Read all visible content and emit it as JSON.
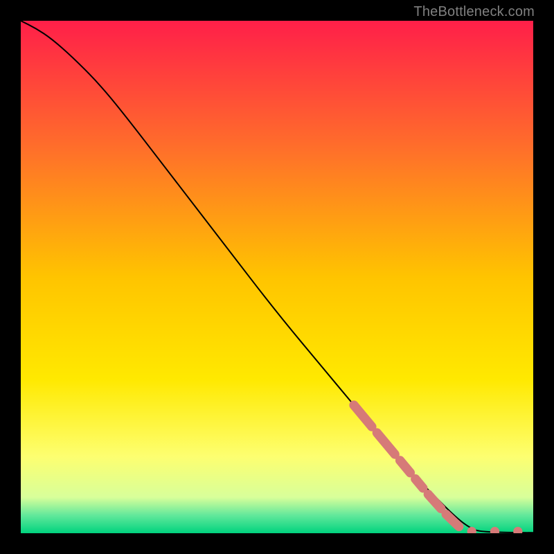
{
  "branding": {
    "text": "TheBottleneck.com"
  },
  "chart_data": {
    "type": "line",
    "title": "",
    "xlabel": "",
    "ylabel": "",
    "xlim": [
      0,
      100
    ],
    "ylim": [
      0,
      100
    ],
    "grid": false,
    "background_gradient": {
      "stops": [
        {
          "offset": 0.0,
          "color": "#ff1f49"
        },
        {
          "offset": 0.25,
          "color": "#ff6f2a"
        },
        {
          "offset": 0.5,
          "color": "#ffc400"
        },
        {
          "offset": 0.7,
          "color": "#ffe900"
        },
        {
          "offset": 0.85,
          "color": "#fdff70"
        },
        {
          "offset": 0.93,
          "color": "#d8ff9a"
        },
        {
          "offset": 0.965,
          "color": "#62e89b"
        },
        {
          "offset": 1.0,
          "color": "#00d37e"
        }
      ]
    },
    "series": [
      {
        "name": "curve",
        "stroke": "#000000",
        "stroke_width": 2,
        "points": [
          {
            "x": 0,
            "y": 100
          },
          {
            "x": 3,
            "y": 98.5
          },
          {
            "x": 6,
            "y": 96.5
          },
          {
            "x": 10,
            "y": 93
          },
          {
            "x": 15,
            "y": 88
          },
          {
            "x": 20,
            "y": 82
          },
          {
            "x": 30,
            "y": 69
          },
          {
            "x": 40,
            "y": 56
          },
          {
            "x": 50,
            "y": 43
          },
          {
            "x": 60,
            "y": 31
          },
          {
            "x": 65,
            "y": 25
          },
          {
            "x": 70,
            "y": 19
          },
          {
            "x": 75,
            "y": 13
          },
          {
            "x": 80,
            "y": 8
          },
          {
            "x": 85,
            "y": 3
          },
          {
            "x": 88,
            "y": 0.8
          },
          {
            "x": 90,
            "y": 0.3
          },
          {
            "x": 95,
            "y": 0.15
          },
          {
            "x": 100,
            "y": 0.1
          }
        ]
      }
    ],
    "markers": {
      "name": "dashed-overlay",
      "color": "#d67a78",
      "dot_radius_units": 0.9,
      "segments": [
        {
          "x1": 65.0,
          "y1": 25.0,
          "x2": 68.5,
          "y2": 20.8
        },
        {
          "x1": 69.5,
          "y1": 19.6,
          "x2": 73.0,
          "y2": 15.4
        },
        {
          "x1": 74.0,
          "y1": 14.2,
          "x2": 76.0,
          "y2": 11.8
        },
        {
          "x1": 77.0,
          "y1": 10.6,
          "x2": 78.5,
          "y2": 8.8
        },
        {
          "x1": 79.5,
          "y1": 7.6,
          "x2": 82.0,
          "y2": 4.8
        },
        {
          "x1": 83.0,
          "y1": 3.7,
          "x2": 85.5,
          "y2": 1.3
        }
      ],
      "dots": [
        {
          "x": 88.0,
          "y": 0.35
        },
        {
          "x": 92.5,
          "y": 0.35
        },
        {
          "x": 97.0,
          "y": 0.35
        }
      ]
    }
  }
}
